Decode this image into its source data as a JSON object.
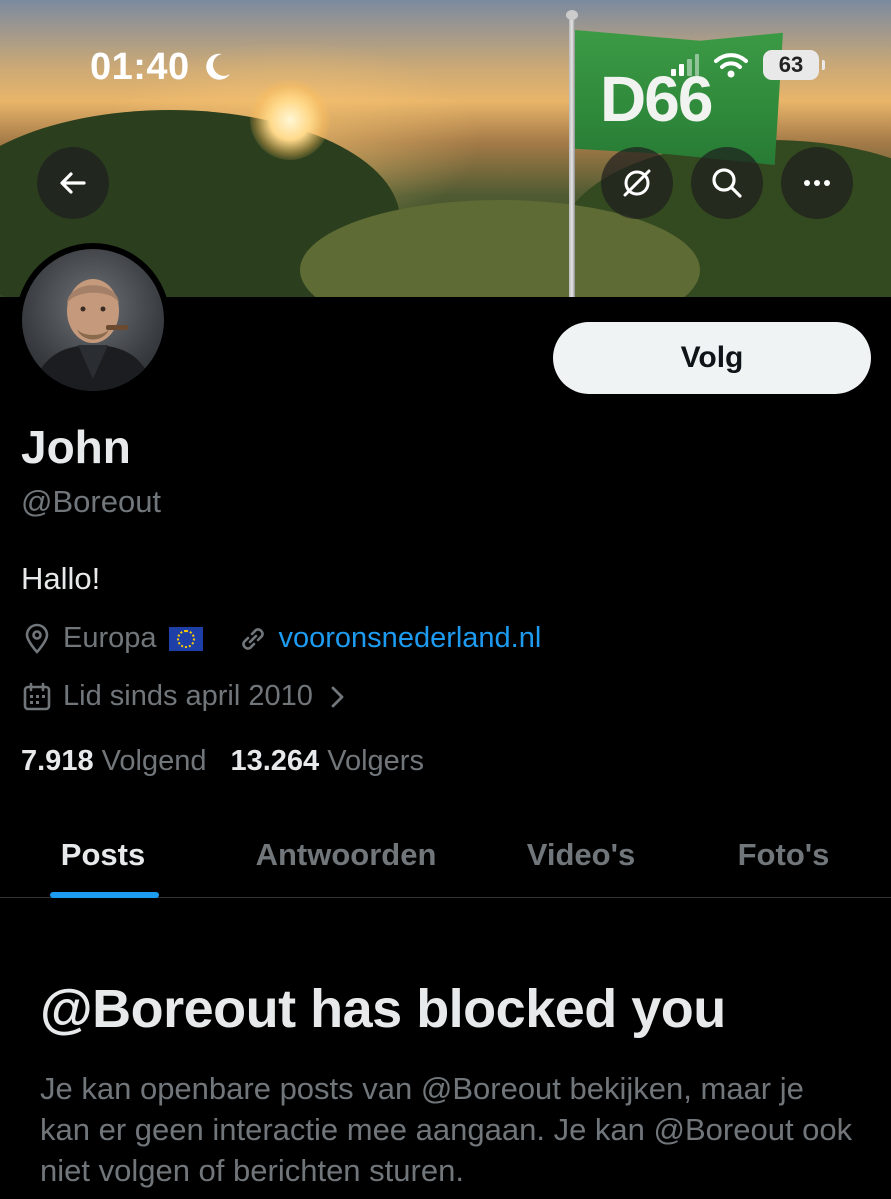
{
  "status_bar": {
    "time": "01:40",
    "battery": "63"
  },
  "banner": {
    "flag_text": "D66"
  },
  "header": {
    "follow_label": "Volg"
  },
  "profile": {
    "name": "John",
    "handle": "@Boreout",
    "bio": "Hallo!",
    "location": "Europa",
    "website": "vooronsnederland.nl",
    "joined": "Lid sinds april 2010",
    "following_count": "7.918",
    "following_label": "Volgend",
    "followers_count": "13.264",
    "followers_label": "Volgers"
  },
  "tabs": [
    {
      "label": "Posts",
      "active": true
    },
    {
      "label": "Antwoorden",
      "active": false
    },
    {
      "label": "Video's",
      "active": false
    },
    {
      "label": "Foto's",
      "active": false
    }
  ],
  "blocked": {
    "title": "@Boreout has blocked you",
    "body": "Je kan openbare posts van @Boreout bekijken, maar je kan er geen interactie mee aangaan. Je kan @Boreout ook niet volgen of berichten sturen."
  },
  "colors": {
    "accent": "#1d9bf0",
    "muted": "#71767b",
    "text": "#e7e9ea"
  }
}
